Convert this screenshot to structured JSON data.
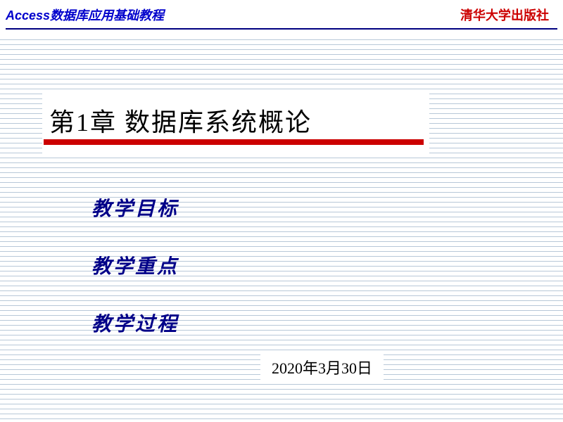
{
  "header": {
    "left_title": "Access数据库应用基础教程",
    "right_publisher": "清华大学出版社"
  },
  "chapter": {
    "title": "第1章  数据库系统概论"
  },
  "sections": {
    "items": [
      {
        "label": "教学目标"
      },
      {
        "label": "教学重点"
      },
      {
        "label": "教学过程"
      }
    ]
  },
  "footer": {
    "date": "2020年3月30日"
  }
}
